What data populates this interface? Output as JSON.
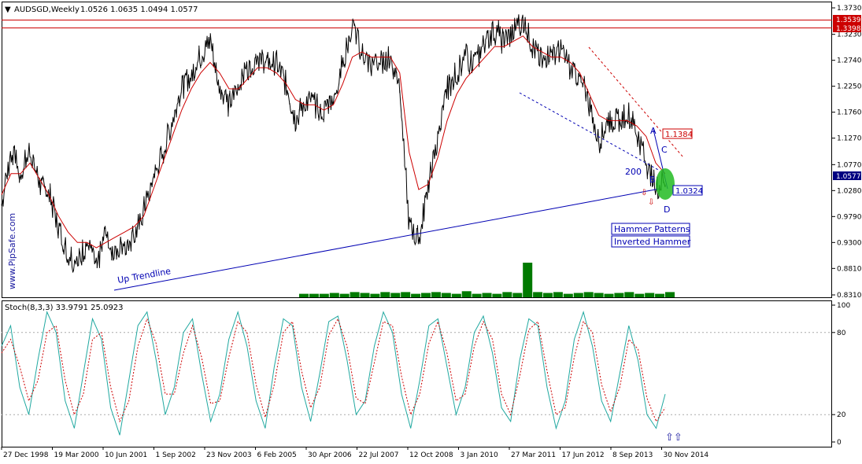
{
  "header": {
    "dropdown_icon": "triangle-down-icon",
    "symbol": "AUDSGD,Weekly",
    "ohlc": "1.0526 1.0635 1.0494 1.0577",
    "stoch_label": "Stoch(8,3,3) 33.9791 25.0923"
  },
  "watermark": "www.PipSafe.com",
  "colors": {
    "price": "#000000",
    "ma": "#cc0000",
    "trendline": "#0000b3",
    "volume": "#007a00",
    "stoch_main": "#20a8a0",
    "stoch_signal": "#cc0000",
    "resistance": "#cc0000",
    "highlight": "#22bb22",
    "current_price_bg": "#000080"
  },
  "chart_data": [
    {
      "type": "line",
      "title": "AUDSGD,Weekly",
      "x_labels": [
        "27 Dec 1998",
        "19 Mar 2000",
        "10 Jun 2001",
        "1 Sep 2002",
        "23 Nov 2003",
        "6 Feb 2005",
        "30 Apr 2006",
        "22 Jul 2007",
        "12 Oct 2008",
        "3 Jan 2010",
        "27 Mar 2011",
        "17 Jun 2012",
        "8 Sep 2013",
        "30 Nov 2014"
      ],
      "y_ticks": [
        "1.3730",
        "1.3230",
        "1.2740",
        "1.2250",
        "1.1760",
        "1.1270",
        "1.0770",
        "1.0280",
        "0.9790",
        "0.9300",
        "0.8810",
        "0.8310"
      ],
      "ylim": [
        0.831,
        1.373
      ],
      "current_price": "1.0577",
      "series": [
        {
          "role": "price",
          "values": [
            1.0,
            1.1,
            1.06,
            1.11,
            1.04,
            1.02,
            0.96,
            0.91,
            0.89,
            0.93,
            0.88,
            0.95,
            0.91,
            0.93,
            0.94,
            0.99,
            1.05,
            1.1,
            1.16,
            1.22,
            1.25,
            1.28,
            1.31,
            1.23,
            1.19,
            1.22,
            1.26,
            1.28,
            1.27,
            1.27,
            1.23,
            1.16,
            1.2,
            1.19,
            1.18,
            1.2,
            1.27,
            1.34,
            1.29,
            1.26,
            1.27,
            1.28,
            1.23,
            0.96,
            0.93,
            1.04,
            1.12,
            1.22,
            1.25,
            1.28,
            1.27,
            1.31,
            1.33,
            1.31,
            1.33,
            1.35,
            1.3,
            1.27,
            1.29,
            1.29,
            1.26,
            1.24,
            1.19,
            1.12,
            1.16,
            1.16,
            1.18,
            1.14,
            1.08,
            1.03,
            1.05
          ]
        },
        {
          "role": "moving-average",
          "label": "200",
          "values": [
            1.02,
            1.06,
            1.06,
            1.08,
            1.05,
            1.02,
            0.98,
            0.95,
            0.93,
            0.93,
            0.92,
            0.93,
            0.94,
            0.95,
            0.96,
            0.98,
            1.03,
            1.08,
            1.13,
            1.18,
            1.22,
            1.25,
            1.27,
            1.25,
            1.22,
            1.22,
            1.24,
            1.26,
            1.26,
            1.25,
            1.23,
            1.2,
            1.19,
            1.19,
            1.18,
            1.19,
            1.23,
            1.28,
            1.29,
            1.28,
            1.28,
            1.28,
            1.25,
            1.1,
            1.03,
            1.04,
            1.09,
            1.16,
            1.21,
            1.24,
            1.26,
            1.28,
            1.3,
            1.3,
            1.31,
            1.32,
            1.3,
            1.29,
            1.28,
            1.28,
            1.27,
            1.25,
            1.21,
            1.17,
            1.16,
            1.16,
            1.16,
            1.15,
            1.13,
            1.08,
            1.06
          ]
        },
        {
          "role": "volume",
          "values": [
            0.2,
            0.2,
            0.2,
            0.25,
            0.2,
            0.3,
            0.25,
            0.2,
            0.3,
            0.25,
            0.3,
            0.2,
            0.25,
            0.3,
            0.25,
            0.2,
            0.35,
            0.2,
            0.25,
            0.2,
            0.3,
            0.25,
            2.0,
            0.3,
            0.25,
            0.3,
            0.2,
            0.25,
            0.3,
            0.25,
            0.2,
            0.25,
            0.3,
            0.2,
            0.25,
            0.2,
            0.3
          ]
        }
      ],
      "levels": [
        "1.3539",
        "1.3398"
      ],
      "annotations": {
        "up_trendline": "Up Trendline",
        "point_a": "A",
        "point_b": "B",
        "point_c": "C",
        "point_d": "D",
        "ma_label": "200",
        "level_c": "1.1384",
        "level_d": "1.0324",
        "pattern_1": "Hammer Patterns",
        "pattern_2": "Inverted Hammer"
      }
    },
    {
      "type": "line",
      "title": "Stoch(8,3,3) 33.9791 25.0923",
      "y_ticks": [
        "100",
        "80",
        "20",
        "0"
      ],
      "ylim": [
        0,
        100
      ],
      "levels": [
        80,
        20
      ],
      "series": [
        {
          "role": "main",
          "values": [
            70,
            85,
            40,
            20,
            60,
            95,
            80,
            30,
            10,
            50,
            90,
            75,
            25,
            5,
            45,
            85,
            95,
            60,
            20,
            40,
            80,
            90,
            50,
            15,
            35,
            75,
            95,
            70,
            30,
            10,
            55,
            90,
            85,
            40,
            15,
            50,
            88,
            92,
            60,
            20,
            30,
            70,
            95,
            80,
            35,
            10,
            45,
            85,
            90,
            55,
            20,
            40,
            80,
            92,
            65,
            25,
            15,
            60,
            90,
            85,
            40,
            10,
            30,
            75,
            95,
            70,
            30,
            15,
            50,
            85,
            60,
            20,
            10,
            35
          ]
        },
        {
          "role": "signal",
          "values": [
            65,
            75,
            55,
            30,
            45,
            80,
            85,
            45,
            20,
            35,
            75,
            80,
            40,
            15,
            30,
            70,
            90,
            72,
            35,
            35,
            65,
            85,
            62,
            28,
            30,
            62,
            88,
            80,
            42,
            18,
            42,
            80,
            88,
            52,
            25,
            40,
            78,
            90,
            70,
            32,
            28,
            58,
            88,
            85,
            48,
            20,
            35,
            72,
            88,
            65,
            30,
            35,
            70,
            88,
            75,
            35,
            20,
            48,
            82,
            88,
            52,
            20,
            25,
            62,
            88,
            80,
            42,
            22,
            40,
            75,
            68,
            32,
            15,
            25
          ]
        }
      ],
      "annotations": {
        "arrow_up_icon": "arrow-up-icon"
      }
    }
  ]
}
